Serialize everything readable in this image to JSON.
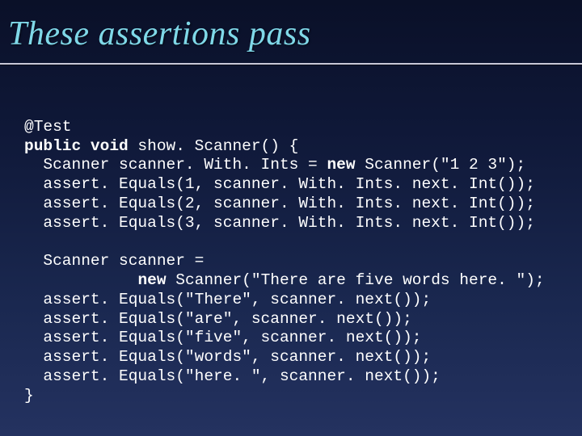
{
  "title": "These assertions pass",
  "code": {
    "l1": "@Test",
    "l2a": "public void",
    "l2b": " show. Scanner() {",
    "l3a": "  Scanner scanner. With. Ints = ",
    "l3b": "new",
    "l3c": " Scanner(\"1 2 3\");",
    "l4": "  assert. Equals(1, scanner. With. Ints. next. Int());",
    "l5": "  assert. Equals(2, scanner. With. Ints. next. Int());",
    "l6": "  assert. Equals(3, scanner. With. Ints. next. Int());",
    "l7": "",
    "l8": "  Scanner scanner =",
    "l9a": "            ",
    "l9b": "new",
    "l9c": " Scanner(\"There are five words here. \");",
    "l10": "  assert. Equals(\"There\", scanner. next());",
    "l11": "  assert. Equals(\"are\", scanner. next());",
    "l12": "  assert. Equals(\"five\", scanner. next());",
    "l13": "  assert. Equals(\"words\", scanner. next());",
    "l14": "  assert. Equals(\"here. \", scanner. next());",
    "l15": "}"
  }
}
